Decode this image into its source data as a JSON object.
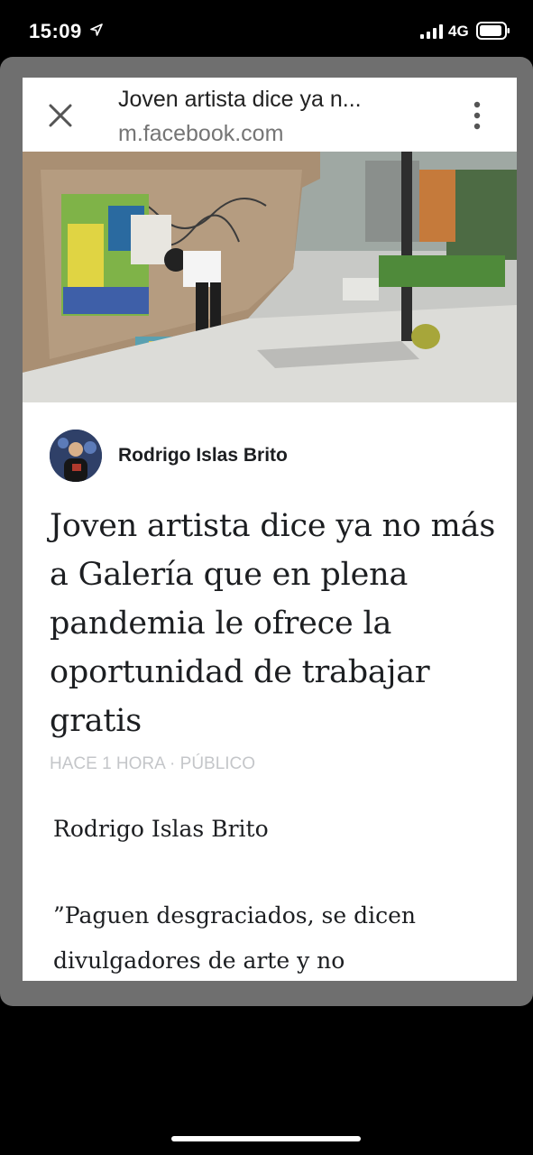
{
  "status_bar": {
    "time": "15:09",
    "network": "4G",
    "icons": [
      "location-arrow-icon",
      "signal-bars-icon",
      "battery-icon"
    ]
  },
  "browser": {
    "page_title": "Joven artista dice ya n...",
    "url": "m.facebook.com",
    "icons": [
      "close-icon",
      "more-vertical-icon"
    ]
  },
  "article": {
    "author": "Rodrigo Islas Brito",
    "headline": "Joven artista dice ya no más a Galería que en plena pandemia le ofrece la oportunidad de trabajar gratis",
    "meta": "HACE 1 HORA · PÚBLICO",
    "byline": "Rodrigo Islas Brito",
    "body_start": "”Paguen desgraciados, se dicen divulgadores de arte y no"
  },
  "colors": {
    "frame": "#6f6f6f",
    "sheet": "#ffffff",
    "text": "#1c1e21",
    "muted_url": "#757575",
    "meta": "#c4c6c9"
  }
}
